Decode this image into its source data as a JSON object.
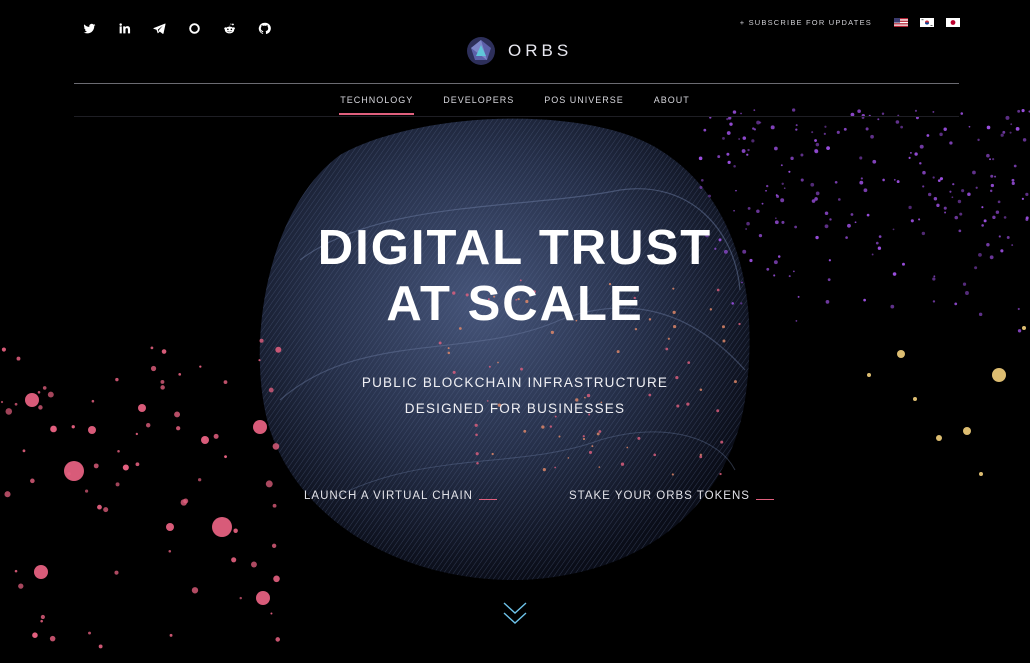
{
  "social": {
    "icons": [
      "twitter-icon",
      "linkedin-icon",
      "telegram-icon",
      "circle-icon",
      "reddit-icon",
      "github-icon"
    ]
  },
  "header": {
    "subscribe_label": "+ SUBSCRIBE FOR UPDATES",
    "flags": [
      "us-flag-icon",
      "kr-flag-icon",
      "jp-flag-icon"
    ],
    "logo_text": "ORBS"
  },
  "nav": {
    "items": [
      {
        "label": "TECHNOLOGY",
        "active": true
      },
      {
        "label": "DEVELOPERS"
      },
      {
        "label": "POS UNIVERSE"
      },
      {
        "label": "ABOUT"
      }
    ]
  },
  "hero": {
    "title_line1": "DIGITAL TRUST",
    "title_line2": "AT SCALE",
    "subtitle_line1": "PUBLIC BLOCKCHAIN INFRASTRUCTURE",
    "subtitle_line2": "DESIGNED FOR BUSINESSES",
    "cta_primary": "LAUNCH A VIRTUAL CHAIN",
    "cta_secondary": "STAKE YOUR ORBS TOKENS"
  },
  "colors": {
    "accent": "#e0607e",
    "background": "#000000",
    "orb": "#2b3550",
    "particle_pink": "#e4607f",
    "particle_purple": "#9b4fe0",
    "particle_gold": "#e9c777"
  }
}
